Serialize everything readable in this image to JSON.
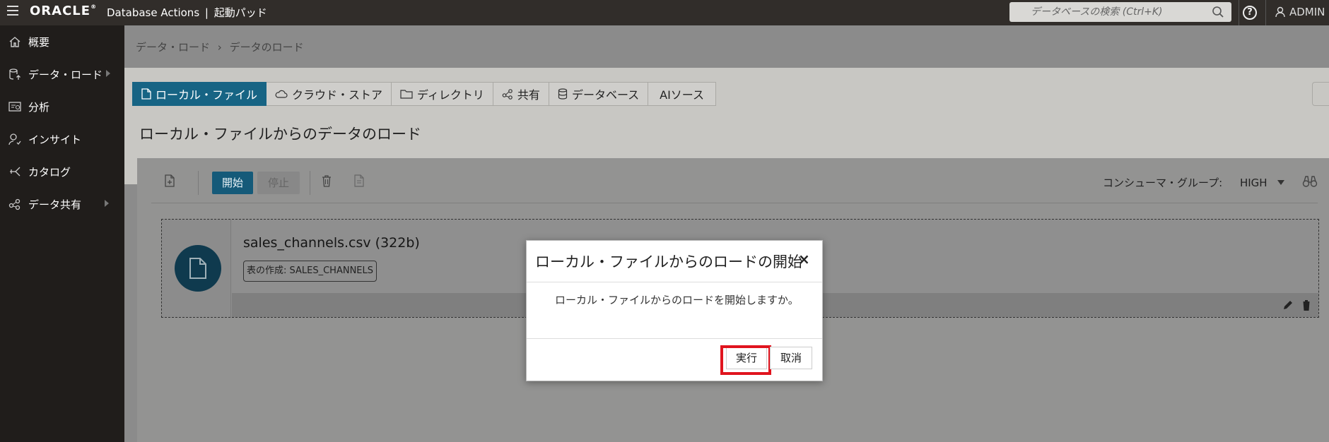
{
  "header": {
    "logo": "ORACLE",
    "logo_reg": "®",
    "app_name": "Database Actions",
    "separator": "|",
    "page": "起動パッド",
    "search_placeholder": "データベースの検索 (Ctrl+K)",
    "help_glyph": "?",
    "user": "ADMIN"
  },
  "sidebar": {
    "items": [
      {
        "label": "概要"
      },
      {
        "label": "データ・ロード"
      },
      {
        "label": "分析"
      },
      {
        "label": "インサイト"
      },
      {
        "label": "カタログ"
      },
      {
        "label": "データ共有"
      }
    ]
  },
  "breadcrumb": {
    "parent": "データ・ロード",
    "chevron": "›",
    "current": "データのロード"
  },
  "tabs": [
    {
      "label": "ローカル・ファイル"
    },
    {
      "label": "クラウド・ストア"
    },
    {
      "label": "ディレクトリ"
    },
    {
      "label": "共有"
    },
    {
      "label": "データベース"
    },
    {
      "label": "AIソース"
    }
  ],
  "page_title": "ローカル・ファイルからのデータのロード",
  "toolbar": {
    "start": "開始",
    "stop": "停止",
    "consumer_label": "コンシューマ・グループ:",
    "consumer_value": "HIGH"
  },
  "file_card": {
    "name": "sales_channels.csv (322b)",
    "badge": "表の作成: SALES_CHANNELS"
  },
  "dialog": {
    "title": "ローカル・ファイルからのロードの開始",
    "close": "×",
    "message": "ローカル・ファイルからのロードを開始しますか。",
    "execute": "実行",
    "cancel": "取消"
  },
  "colors": {
    "topbar": "#312d2a",
    "sidebar": "#201d1b",
    "active_tab": "#176484",
    "highlight": "#e0141e"
  }
}
